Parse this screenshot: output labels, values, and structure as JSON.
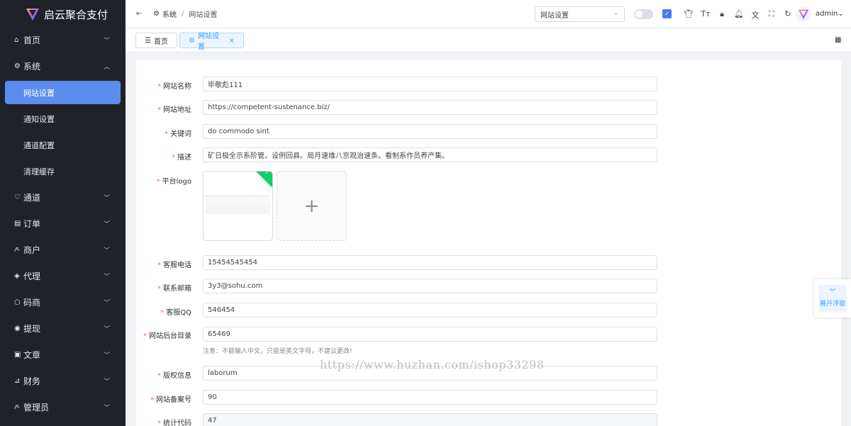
{
  "app": {
    "title": "启云聚合支付"
  },
  "sidebar": {
    "items": [
      {
        "label": "首页",
        "icon": "home-icon",
        "glyph": "⌂",
        "expanded": false
      },
      {
        "label": "系统",
        "icon": "gear-icon",
        "glyph": "⚙",
        "expanded": true,
        "children": [
          {
            "label": "网站设置",
            "active": true
          },
          {
            "label": "通知设置"
          },
          {
            "label": "通道配置"
          },
          {
            "label": "清理缓存"
          }
        ]
      },
      {
        "label": "通道",
        "icon": "heart-icon",
        "glyph": "♡",
        "expanded": false
      },
      {
        "label": "订单",
        "icon": "clipboard-icon",
        "glyph": "▤",
        "expanded": false
      },
      {
        "label": "商户",
        "icon": "user-icon",
        "glyph": "ዶ",
        "expanded": false
      },
      {
        "label": "代理",
        "icon": "agent-icon",
        "glyph": "◈",
        "expanded": false
      },
      {
        "label": "码商",
        "icon": "circle-icon",
        "glyph": "○",
        "expanded": false
      },
      {
        "label": "提现",
        "icon": "target-icon",
        "glyph": "◉",
        "expanded": false
      },
      {
        "label": "文章",
        "icon": "document-icon",
        "glyph": "▣",
        "expanded": false
      },
      {
        "label": "财务",
        "icon": "chart-icon",
        "glyph": "⊿",
        "expanded": false
      },
      {
        "label": "管理员",
        "icon": "admin-icon",
        "glyph": "ዶ",
        "expanded": false
      }
    ]
  },
  "header": {
    "breadcrumb": [
      "系统",
      "网站设置"
    ],
    "page_select": "网站设置",
    "username": "admin"
  },
  "tabs": [
    {
      "label": "首页",
      "active": false
    },
    {
      "label": "网站设置",
      "active": true
    }
  ],
  "form": {
    "fields": [
      {
        "label": "网站名称",
        "value": "毕敬彪111"
      },
      {
        "label": "网站地址",
        "value": "https://competent-sustenance.biz/"
      },
      {
        "label": "关键词",
        "value": "do commodo sint"
      },
      {
        "label": "描述",
        "value": "矿日极全示系阶管。设例回县。局月速维八京观治速条。看制系作员养产集。"
      },
      {
        "label": "平台logo"
      },
      {
        "label": "客服电话",
        "value": "15454545454"
      },
      {
        "label": "联系邮箱",
        "value": "3y3@sohu.com"
      },
      {
        "label": "客服QQ",
        "value": "546454"
      },
      {
        "label": "网站后台目录",
        "value": "65469"
      },
      {
        "label": "版权信息",
        "value": "laborum"
      },
      {
        "label": "网站备案号",
        "value": "90"
      },
      {
        "label": "统计代码",
        "value": "47"
      }
    ],
    "admin_dir_hint": "注意：不能输入中文，只能是英文字母，不建议更改!"
  },
  "float_panel": {
    "label": "展开浮窗"
  },
  "watermark": "https://www.huzhan.com/ishop33298",
  "colors": {
    "sidebar_bg": "#1f2329",
    "accent": "#5a8dee",
    "required": "#f56c6c",
    "success": "#13ce66"
  }
}
